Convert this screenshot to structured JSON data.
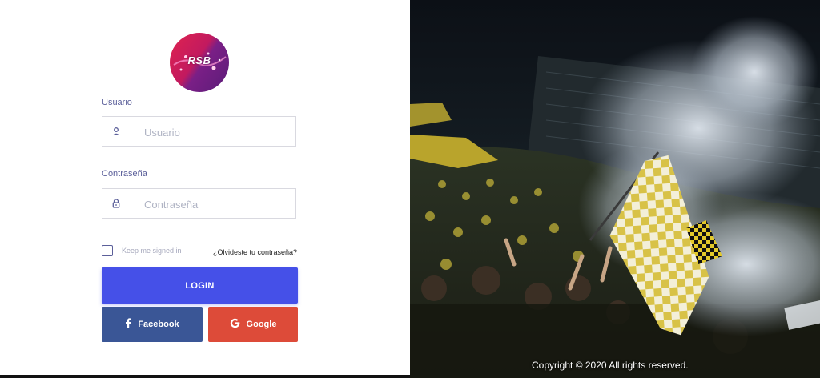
{
  "logo": {
    "text": "RSB"
  },
  "form": {
    "username": {
      "label": "Usuario",
      "placeholder": "Usuario"
    },
    "password": {
      "label": "Contraseña",
      "placeholder": "Contraseña"
    },
    "keep_signed_in": "Keep me signed in",
    "forgot_password": "¿Olvideste tu contraseña?",
    "login_button": "LOGIN",
    "facebook_button": "Facebook",
    "google_button": "Google"
  },
  "icons": {
    "username": "user-icon",
    "password": "lock-icon",
    "facebook": "facebook-icon",
    "google": "google-icon"
  },
  "colors": {
    "accent": "#4550e8",
    "facebook": "#3a5696",
    "google": "#dd4b39",
    "label": "#5b5f9a"
  },
  "background": {
    "scene": "stadium-crowd-with-flags-and-smoke"
  },
  "footer": {
    "copyright": "Copyright © 2020 All rights reserved."
  }
}
